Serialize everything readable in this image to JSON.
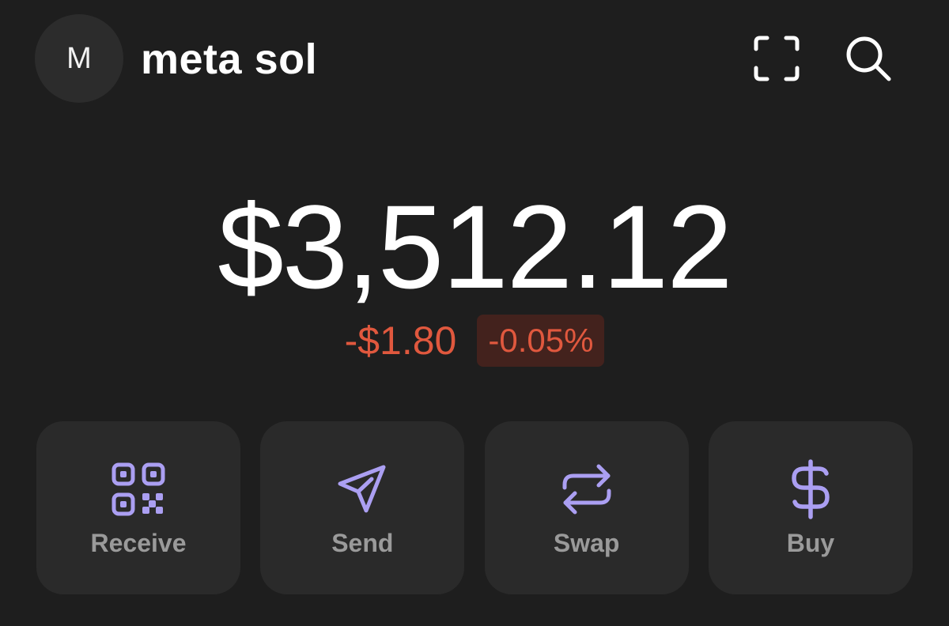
{
  "header": {
    "avatar_initial": "M",
    "account_name": "meta sol",
    "scan_icon": "scan-icon",
    "search_icon": "search-icon"
  },
  "balance": {
    "total": "$3,512.12",
    "change_amount": "-$1.80",
    "change_percent": "-0.05%"
  },
  "actions": [
    {
      "label": "Receive",
      "icon": "qr-code-icon"
    },
    {
      "label": "Send",
      "icon": "send-icon"
    },
    {
      "label": "Swap",
      "icon": "swap-icon"
    },
    {
      "label": "Buy",
      "icon": "dollar-icon"
    }
  ],
  "colors": {
    "background": "#1e1e1e",
    "card": "#2a2a2a",
    "accent": "#ab9ff2",
    "negative": "#e0583e",
    "negative_bg": "#43221d",
    "label": "#9a9a9a"
  }
}
